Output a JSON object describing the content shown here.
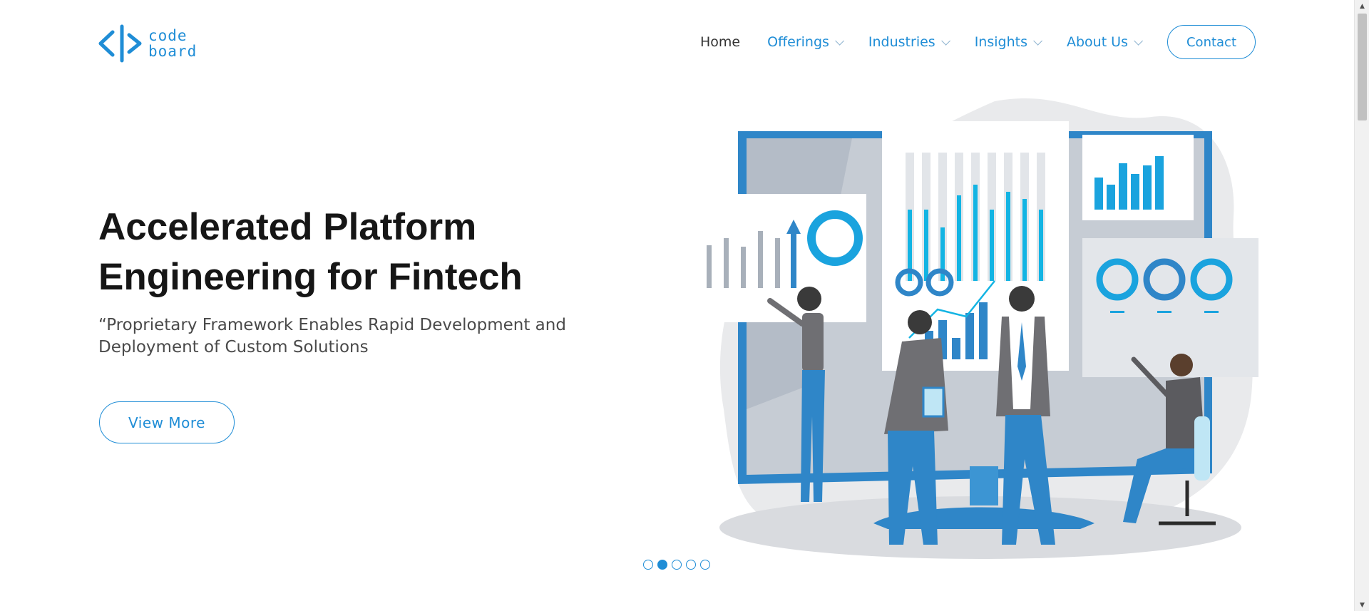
{
  "brand": {
    "logo_text_line1": "code",
    "logo_text_line2": "board",
    "accent_color": "#1f8dd6"
  },
  "nav": {
    "items": [
      {
        "label": "Home",
        "has_dropdown": false
      },
      {
        "label": "Offerings",
        "has_dropdown": true
      },
      {
        "label": "Industries",
        "has_dropdown": true
      },
      {
        "label": "Insights",
        "has_dropdown": true
      },
      {
        "label": "About Us",
        "has_dropdown": true
      }
    ],
    "contact_label": "Contact"
  },
  "hero": {
    "title": "Accelerated Platform Engineering for Fintech",
    "subtitle": "“Proprietary Framework Enables Rapid Development and Deployment of Custom Solutions",
    "cta_label": "View More"
  },
  "carousel": {
    "slide_count": 5,
    "active_index": 1
  },
  "icons": [
    "code-brackets-logo-icon",
    "chevron-down-icon",
    "scroll-up-arrow-icon",
    "scroll-down-arrow-icon"
  ]
}
